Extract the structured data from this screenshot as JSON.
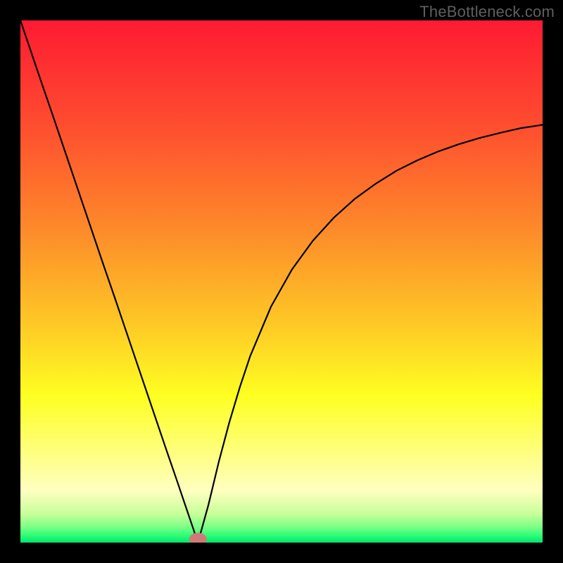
{
  "watermark": "TheBottleneck.com",
  "colors": {
    "frame": "#000000",
    "curve": "#000000",
    "marker_fill": "#cf7a77",
    "gradient_stops": [
      {
        "offset": 0.0,
        "color": "#fe1a32"
      },
      {
        "offset": 0.2,
        "color": "#fe4d2f"
      },
      {
        "offset": 0.4,
        "color": "#fd8a2a"
      },
      {
        "offset": 0.58,
        "color": "#fec826"
      },
      {
        "offset": 0.72,
        "color": "#feff22"
      },
      {
        "offset": 0.82,
        "color": "#feff78"
      },
      {
        "offset": 0.9,
        "color": "#ffffc0"
      },
      {
        "offset": 0.945,
        "color": "#c7ff9a"
      },
      {
        "offset": 0.97,
        "color": "#7cff86"
      },
      {
        "offset": 0.985,
        "color": "#33ff78"
      },
      {
        "offset": 1.0,
        "color": "#00e56e"
      }
    ]
  },
  "chart_data": {
    "type": "line",
    "title": "",
    "xlabel": "",
    "ylabel": "",
    "xlim": [
      0,
      1
    ],
    "ylim": [
      0,
      1
    ],
    "marker": {
      "x": 0.34,
      "y": 0.0,
      "rx": 0.017,
      "ry": 0.012
    },
    "series": [
      {
        "name": "bottleneck-curve",
        "x": [
          0.0,
          0.02,
          0.04,
          0.06,
          0.08,
          0.1,
          0.12,
          0.14,
          0.16,
          0.18,
          0.2,
          0.22,
          0.24,
          0.26,
          0.28,
          0.3,
          0.32,
          0.34,
          0.36,
          0.38,
          0.4,
          0.42,
          0.44,
          0.48,
          0.52,
          0.56,
          0.6,
          0.64,
          0.68,
          0.72,
          0.76,
          0.8,
          0.84,
          0.88,
          0.92,
          0.96,
          1.0
        ],
        "y": [
          1.0,
          0.941,
          0.882,
          0.824,
          0.765,
          0.706,
          0.647,
          0.588,
          0.529,
          0.471,
          0.412,
          0.353,
          0.294,
          0.235,
          0.176,
          0.118,
          0.059,
          0.0,
          0.072,
          0.155,
          0.23,
          0.297,
          0.357,
          0.452,
          0.523,
          0.578,
          0.622,
          0.658,
          0.687,
          0.712,
          0.732,
          0.749,
          0.763,
          0.775,
          0.785,
          0.794,
          0.8
        ]
      }
    ]
  }
}
